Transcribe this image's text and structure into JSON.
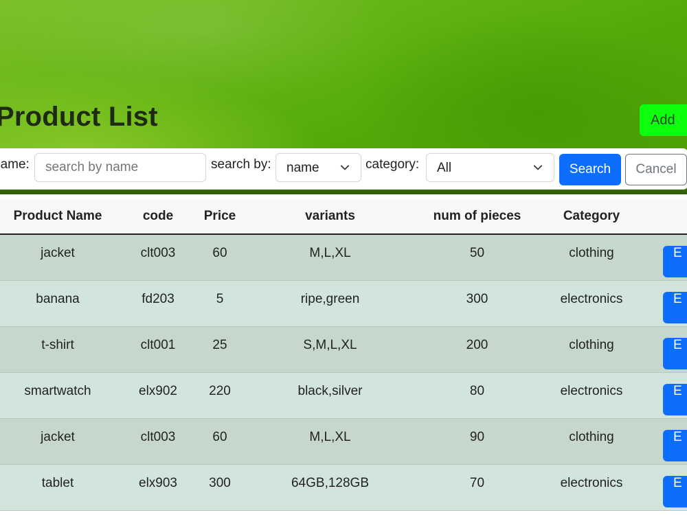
{
  "header": {
    "title": "Product List",
    "add_label": "Add"
  },
  "search": {
    "name_label": "name:",
    "name_placeholder": "search by name",
    "search_by_label": "search by:",
    "search_by_value": "name",
    "category_label": "category:",
    "category_value": "All",
    "search_button": "Search",
    "cancel_button": "Cancel"
  },
  "table": {
    "columns": [
      "Product Name",
      "code",
      "Price",
      "variants",
      "num of pieces",
      "Category",
      ""
    ],
    "edit_label": "E",
    "rows": [
      {
        "name": "jacket",
        "code": "clt003",
        "price": "60",
        "variants": "M,L,XL",
        "pieces": "50",
        "category": "clothing"
      },
      {
        "name": "banana",
        "code": "fd203",
        "price": "5",
        "variants": "ripe,green",
        "pieces": "300",
        "category": "electronics"
      },
      {
        "name": "t-shirt",
        "code": "clt001",
        "price": "25",
        "variants": "S,M,L,XL",
        "pieces": "200",
        "category": "clothing"
      },
      {
        "name": "smartwatch",
        "code": "elx902",
        "price": "220",
        "variants": "black,silver",
        "pieces": "80",
        "category": "electronics"
      },
      {
        "name": "jacket",
        "code": "clt003",
        "price": "60",
        "variants": "M,L,XL",
        "pieces": "90",
        "category": "clothing"
      },
      {
        "name": "tablet",
        "code": "elx903",
        "price": "300",
        "variants": "64GB,128GB",
        "pieces": "70",
        "category": "electronics"
      }
    ]
  },
  "colors": {
    "primary": "#0d6efd",
    "add_button": "#0dff0d",
    "row_odd": "#c6d7ce",
    "row_even": "#d2e5dc"
  },
  "icons": {
    "dropdown": "chevron-down-icon"
  }
}
